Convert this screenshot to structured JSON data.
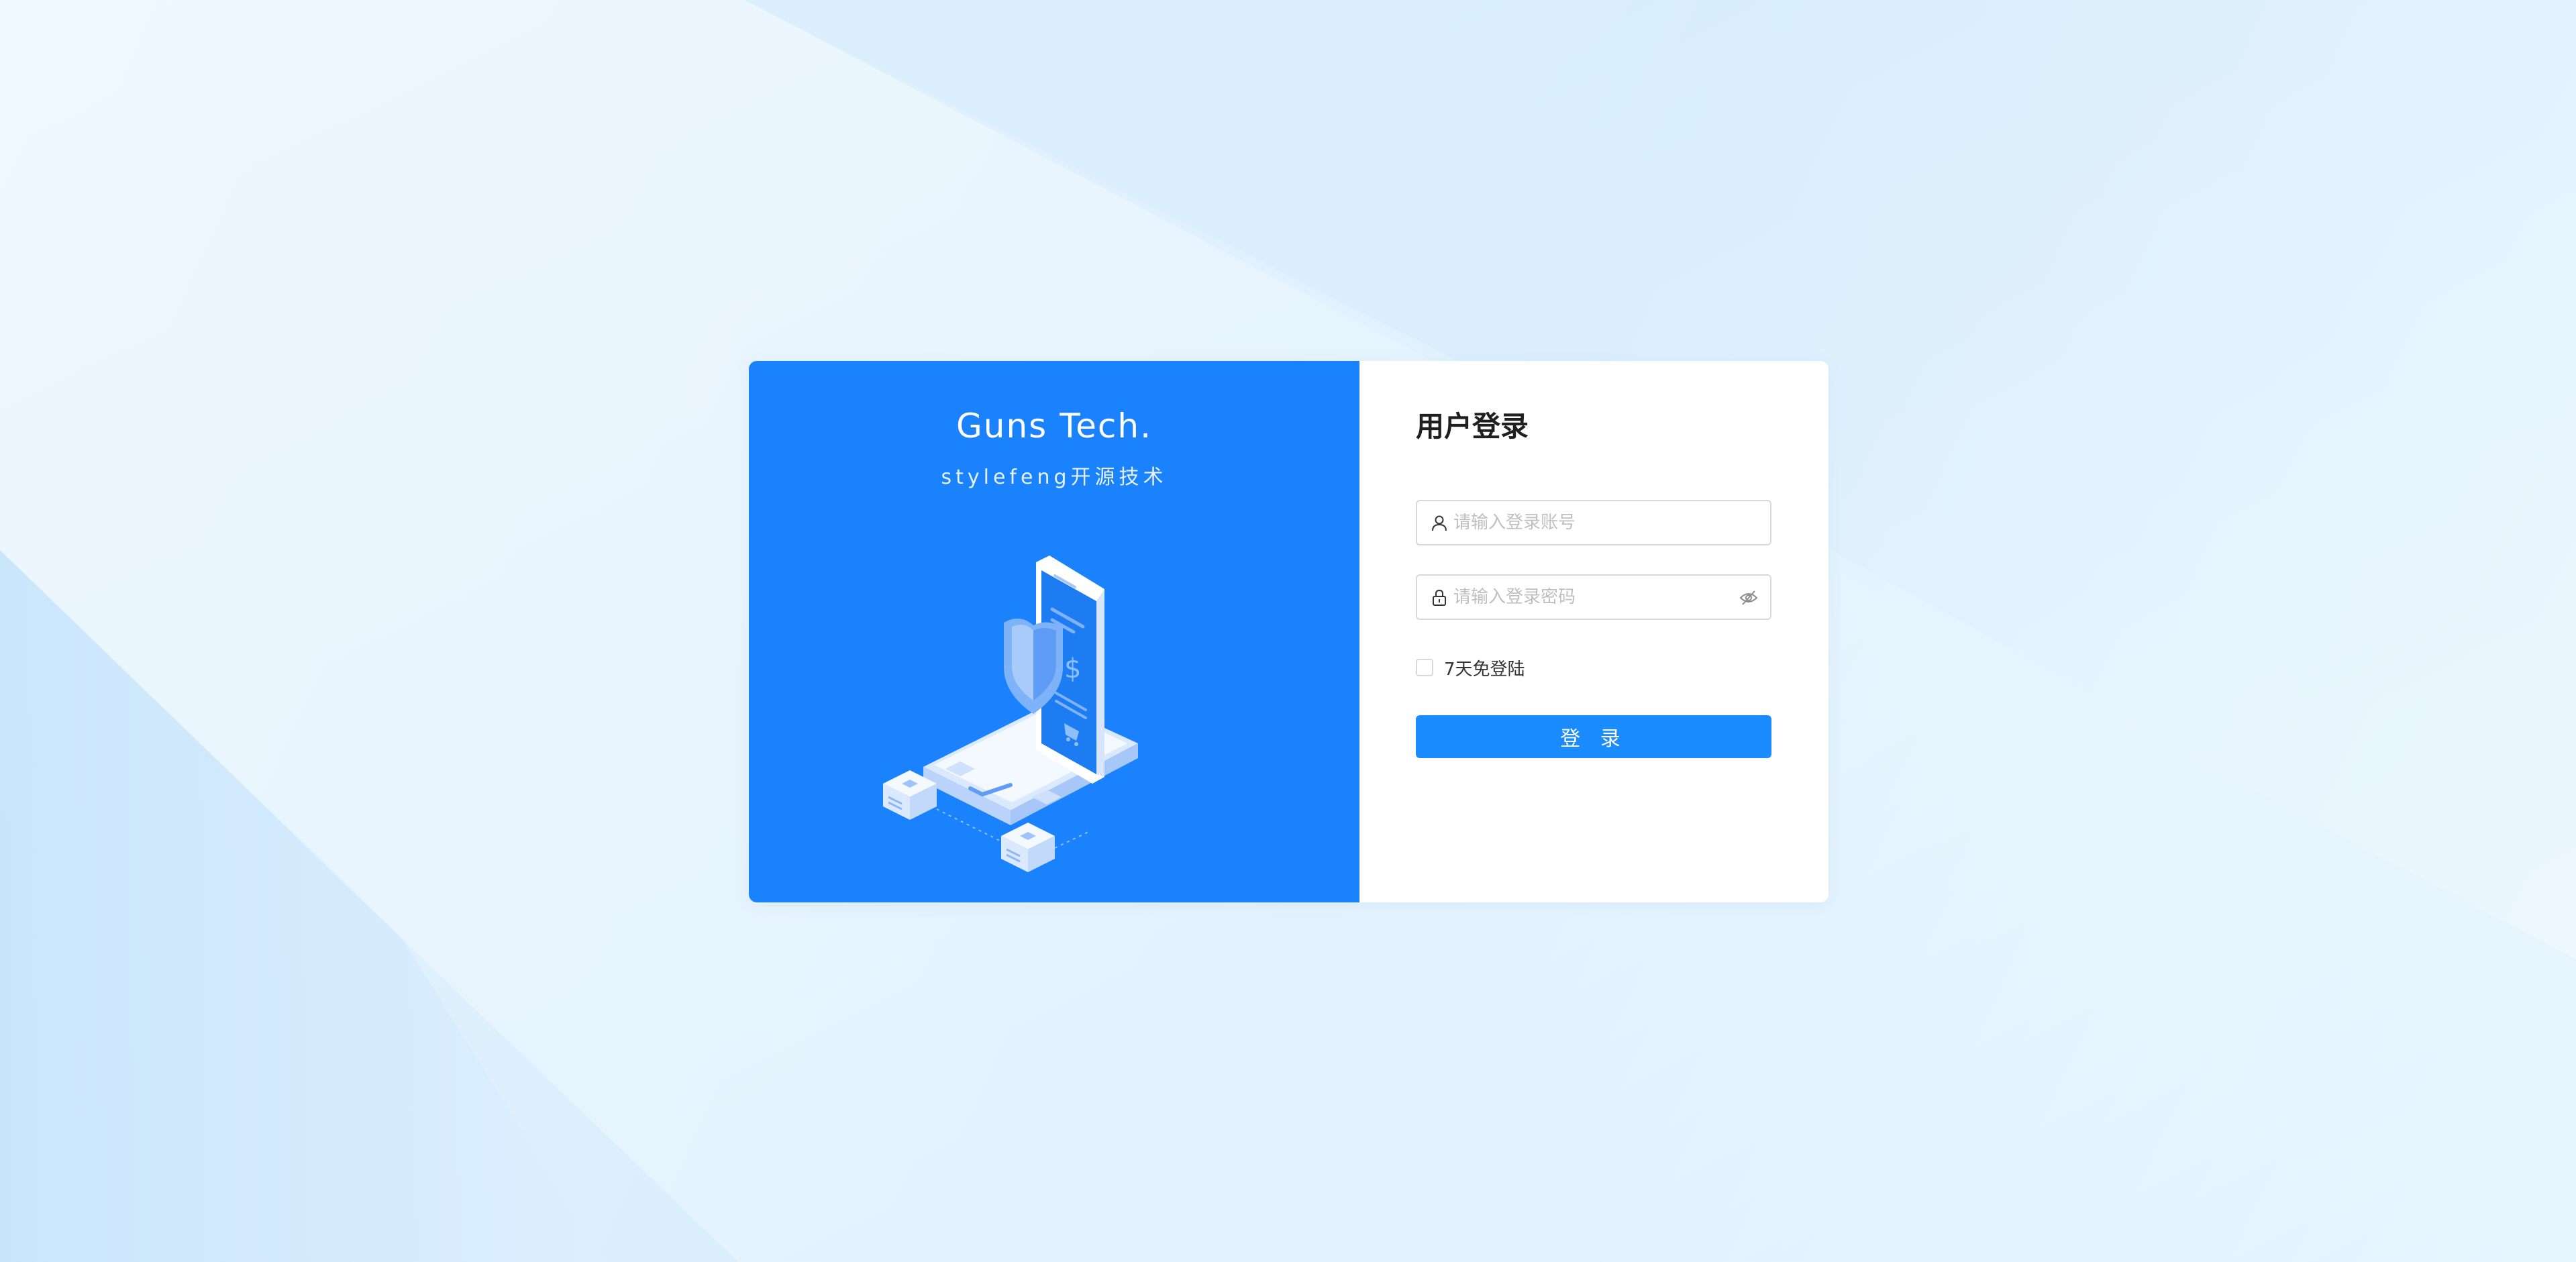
{
  "brand": {
    "title": "Guns Tech.",
    "subtitle": "stylefeng开源技术"
  },
  "login": {
    "title": "用户登录",
    "username": {
      "placeholder": "请输入登录账号",
      "value": "",
      "icon": "user-icon"
    },
    "password": {
      "placeholder": "请输入登录密码",
      "value": "",
      "icon": "lock-icon",
      "toggle_icon": "eye-invisible-icon"
    },
    "remember_label": "7天免登陆",
    "remember_checked": false,
    "submit_label": "登 录"
  },
  "colors": {
    "brand_panel": "#1a82fc",
    "primary_button": "#1a8cff",
    "background": "#e3f2fd"
  }
}
